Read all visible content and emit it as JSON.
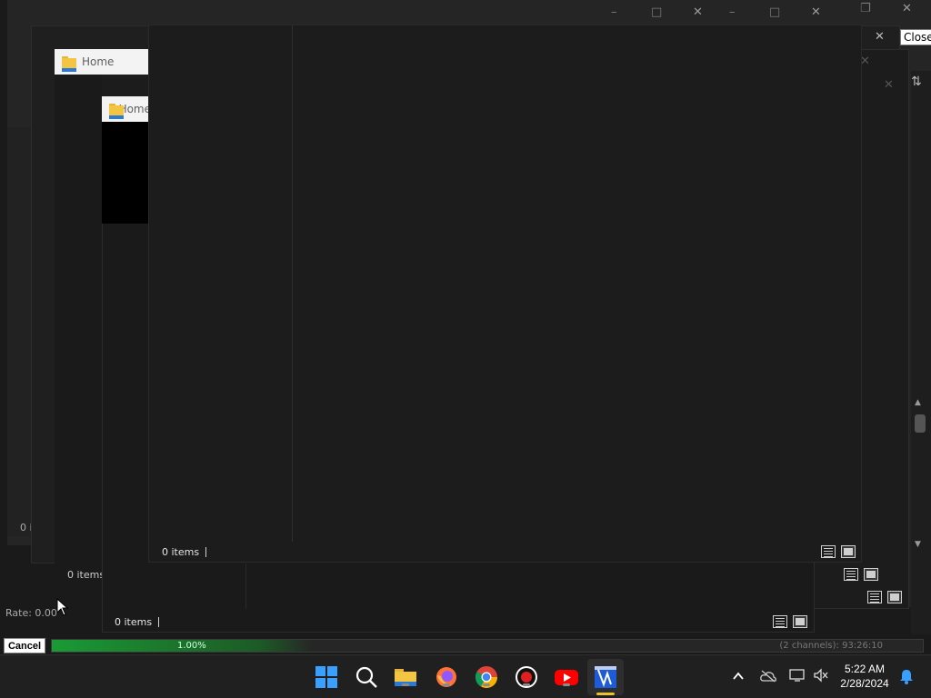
{
  "tooltip": {
    "close": "Close"
  },
  "windows": {
    "back": {
      "status": "0 i",
      "rate": "Rate: 0.00",
      "cancel_label": "Cancel",
      "progress_label": "1.00%",
      "progress_fraction": 0.3,
      "channels_label": "(2 channels): 93:26:10"
    },
    "w2": {
      "status": "0 i"
    },
    "w3": {
      "tab": "Home",
      "status": "0 items",
      "status_short": "0 i"
    },
    "w4": {
      "tab": "Home",
      "status": "0 items"
    },
    "front": {
      "status": "0 items"
    }
  },
  "controls": {
    "minimize": "–",
    "maximize": "□",
    "restore": "❐",
    "close": "✕"
  },
  "taskbar": {
    "clock_time": "5:22 AM",
    "clock_date": "2/28/2024",
    "apps": [
      "start-icon",
      "search-icon",
      "file-explorer-icon",
      "firefox-icon",
      "chrome-icon",
      "record-icon",
      "youtube-icon",
      "video-editor-icon"
    ],
    "tray": [
      "chevron-up-icon",
      "onedrive-icon",
      "network-icon",
      "volume-muted-icon",
      "notification-bell-icon"
    ]
  },
  "colors": {
    "window_bg": "#1c1c1c",
    "taskbar_bg": "#202020",
    "progress_green": "#1a9b35",
    "accent_blue": "#3aa0ff"
  }
}
